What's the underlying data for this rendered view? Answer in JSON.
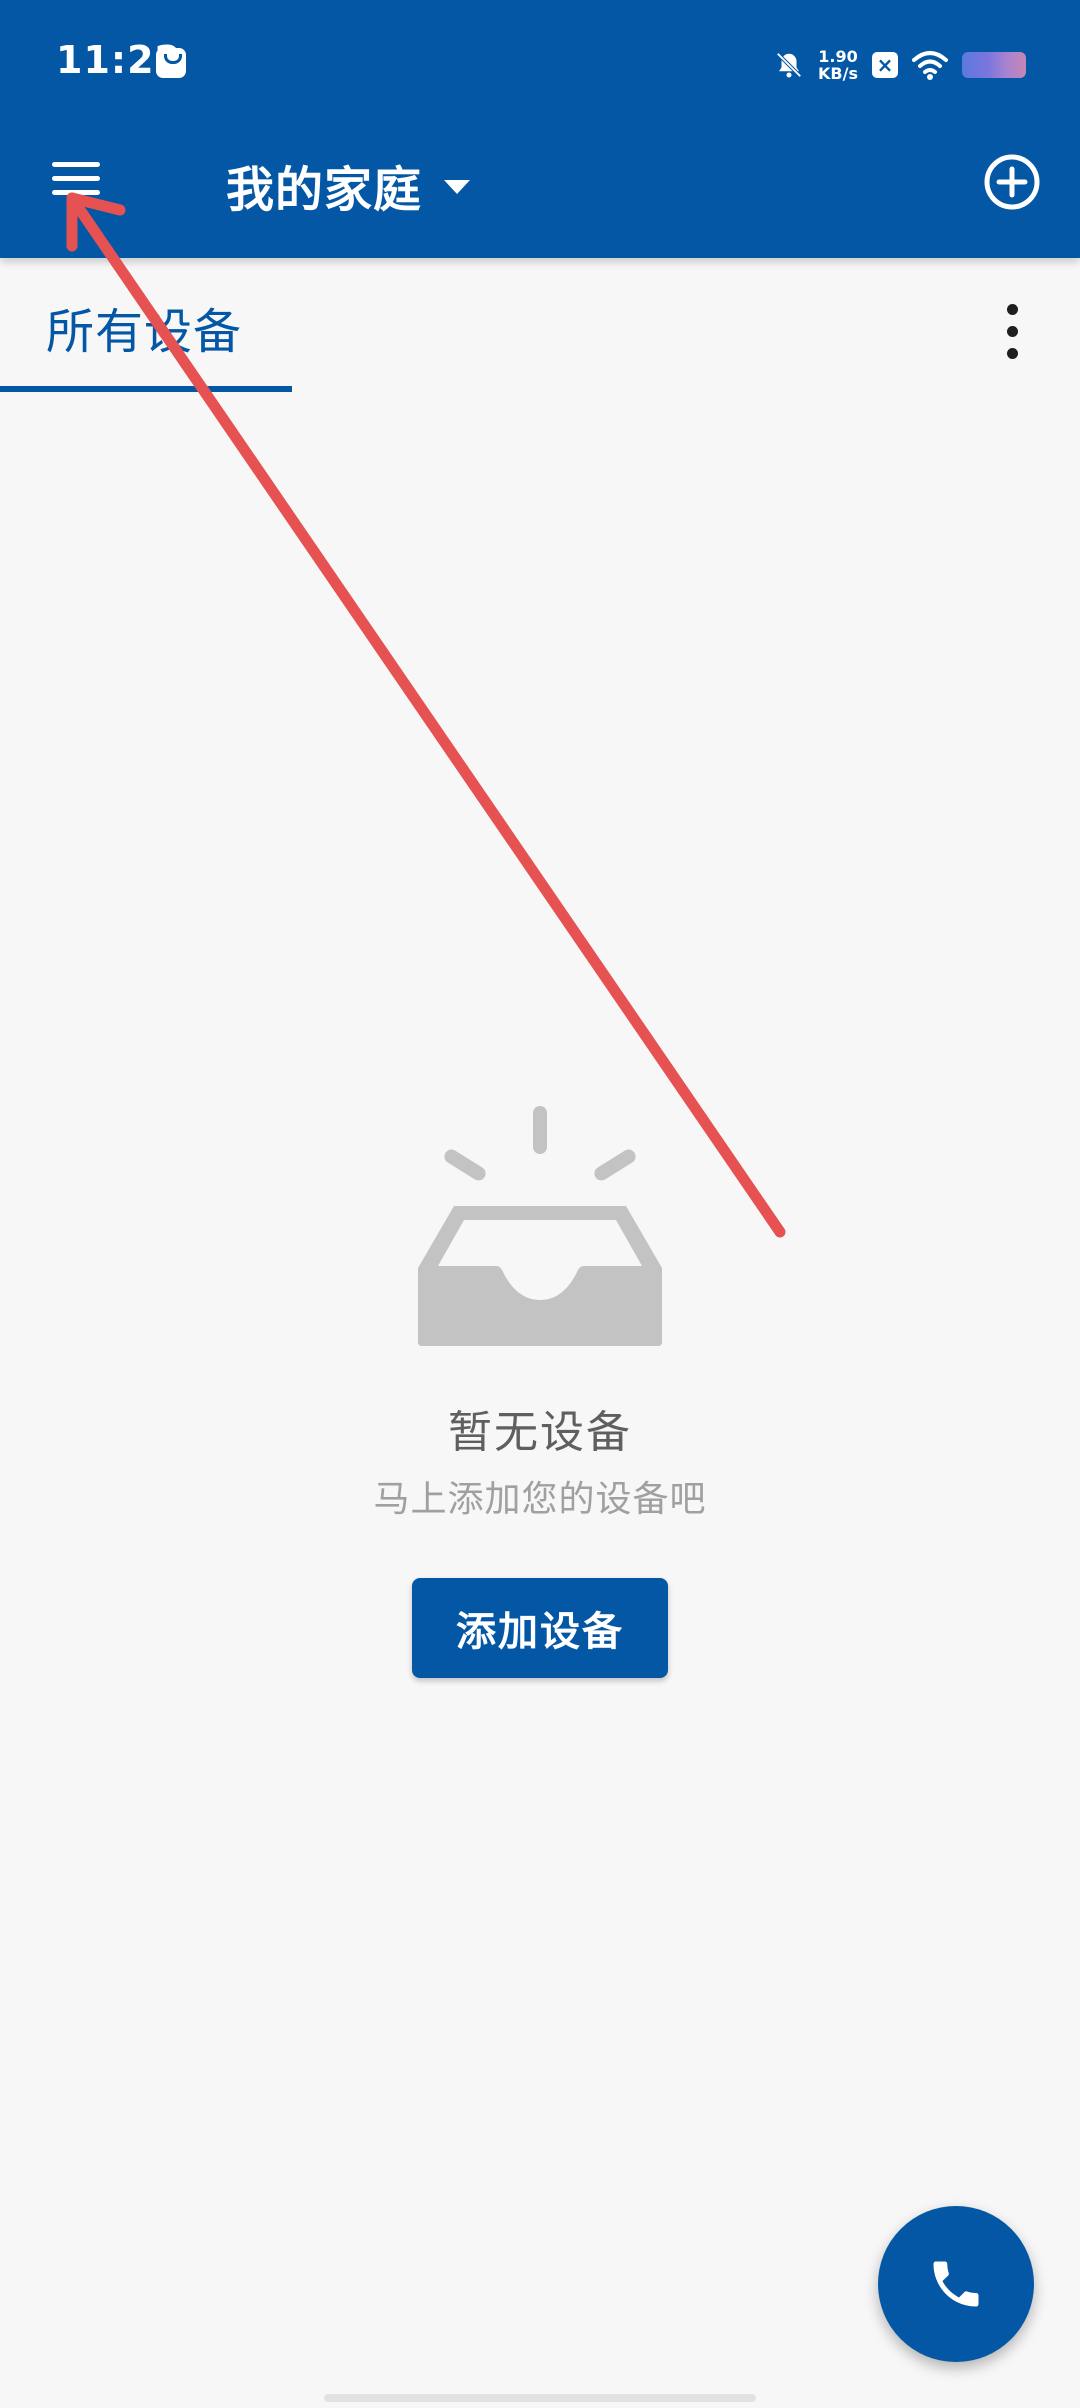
{
  "status_bar": {
    "time": "11:22",
    "network_speed_value": "1.90",
    "network_speed_unit": "KB/s",
    "icons": [
      "app-notification-icon",
      "bell-muted-icon",
      "close-box-icon",
      "wifi-icon",
      "battery-icon"
    ]
  },
  "app_bar": {
    "home_name": "我的家庭",
    "menu_icon": "menu-icon",
    "dropdown_icon": "chevron-down-icon",
    "add_icon": "add-circle-icon"
  },
  "tabs": {
    "items": [
      {
        "label": "所有设备",
        "selected": true
      }
    ],
    "more_icon": "more-vert-icon"
  },
  "empty_state": {
    "icon": "empty-inbox-icon",
    "title": "暂无设备",
    "subtitle": "马上添加您的设备吧",
    "button_label": "添加设备"
  },
  "fab": {
    "icon": "phone-icon"
  },
  "colors": {
    "primary": "#0457a4",
    "background": "#f7f7f8",
    "empty_icon": "#c3c3c3",
    "annotation": "#e65252"
  }
}
